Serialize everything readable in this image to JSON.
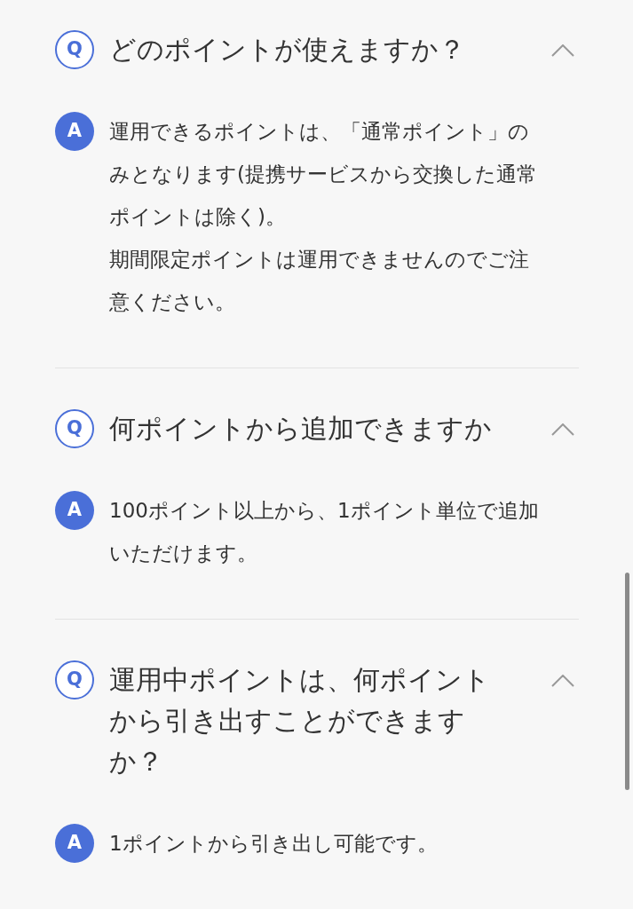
{
  "faq": [
    {
      "q_mark": "Q",
      "question": "どのポイントが使えますか？",
      "expanded": true,
      "a_mark": "A",
      "answer": [
        "運用できるポイントは、「通常ポイント」のみとなります(提携サービスから交換した通常ポイントは除く)。",
        "期間限定ポイントは運用できませんのでご注意ください。"
      ]
    },
    {
      "q_mark": "Q",
      "question": "何ポイントから追加できますか",
      "expanded": true,
      "a_mark": "A",
      "answer": [
        "100ポイント以上から、1ポイント単位で追加いただけます。"
      ]
    },
    {
      "q_mark": "Q",
      "question": "運用中ポイントは、何ポイントから引き出すことができますか？",
      "expanded": true,
      "a_mark": "A",
      "answer": [
        "1ポイントから引き出し可能です。"
      ]
    }
  ]
}
